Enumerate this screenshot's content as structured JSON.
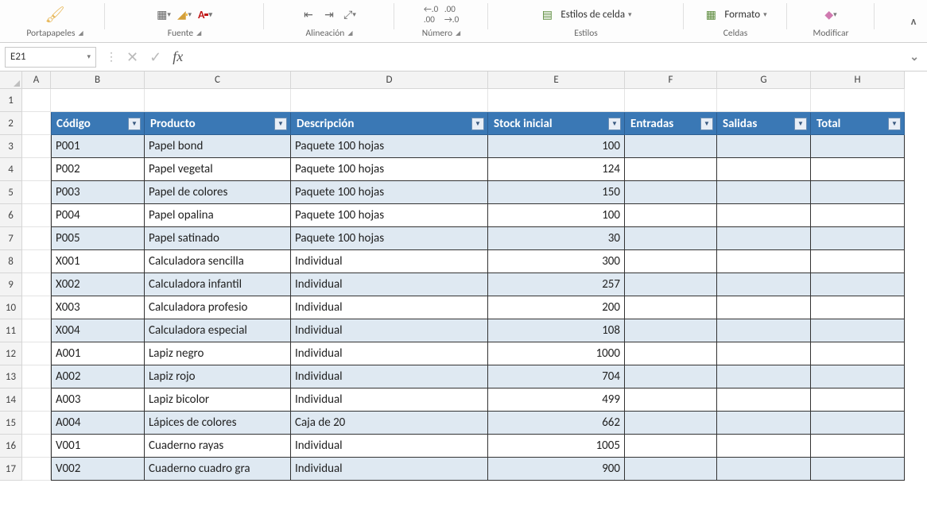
{
  "ribbon": {
    "groups": {
      "portapapeles": "Portapapeles",
      "fuente": "Fuente",
      "alineacion": "Alineación",
      "numero": "Número",
      "estilos": "Estilos",
      "celdas": "Celdas",
      "modificar": "Modificar"
    },
    "buttons": {
      "estilos_celda": "Estilos de celda",
      "formato": "Formato"
    }
  },
  "nameBox": "E21",
  "formulaBar": "",
  "columns": [
    "A",
    "B",
    "C",
    "D",
    "E",
    "F",
    "G",
    "H"
  ],
  "rowNumbers": [
    "1",
    "2",
    "3",
    "4",
    "5",
    "6",
    "7",
    "8",
    "9",
    "10",
    "11",
    "12",
    "13",
    "14",
    "15",
    "16",
    "17"
  ],
  "table": {
    "headers": [
      "Código",
      "Producto",
      "Descripción",
      "Stock inicial",
      "Entradas",
      "Salidas",
      "Total"
    ],
    "rows": [
      {
        "codigo": "P001",
        "producto": "Papel bond",
        "descripcion": "Paquete 100 hojas",
        "stock": "100",
        "entradas": "",
        "salidas": "",
        "total": ""
      },
      {
        "codigo": "P002",
        "producto": "Papel vegetal",
        "descripcion": "Paquete 100 hojas",
        "stock": "124",
        "entradas": "",
        "salidas": "",
        "total": ""
      },
      {
        "codigo": "P003",
        "producto": "Papel de colores",
        "descripcion": "Paquete 100 hojas",
        "stock": "150",
        "entradas": "",
        "salidas": "",
        "total": ""
      },
      {
        "codigo": "P004",
        "producto": "Papel opalina",
        "descripcion": "Paquete 100 hojas",
        "stock": "100",
        "entradas": "",
        "salidas": "",
        "total": ""
      },
      {
        "codigo": "P005",
        "producto": "Papel satinado",
        "descripcion": "Paquete 100 hojas",
        "stock": "30",
        "entradas": "",
        "salidas": "",
        "total": ""
      },
      {
        "codigo": "X001",
        "producto": "Calculadora sencilla",
        "descripcion": "Individual",
        "stock": "300",
        "entradas": "",
        "salidas": "",
        "total": ""
      },
      {
        "codigo": "X002",
        "producto": "Calculadora infantil",
        "descripcion": "Individual",
        "stock": "257",
        "entradas": "",
        "salidas": "",
        "total": ""
      },
      {
        "codigo": "X003",
        "producto": "Calculadora profesio",
        "descripcion": "Individual",
        "stock": "200",
        "entradas": "",
        "salidas": "",
        "total": ""
      },
      {
        "codigo": "X004",
        "producto": "Calculadora especial",
        "descripcion": "Individual",
        "stock": "108",
        "entradas": "",
        "salidas": "",
        "total": ""
      },
      {
        "codigo": "A001",
        "producto": "Lapiz negro",
        "descripcion": "Individual",
        "stock": "1000",
        "entradas": "",
        "salidas": "",
        "total": ""
      },
      {
        "codigo": "A002",
        "producto": "Lapiz rojo",
        "descripcion": "Individual",
        "stock": "704",
        "entradas": "",
        "salidas": "",
        "total": ""
      },
      {
        "codigo": "A003",
        "producto": "Lapiz bicolor",
        "descripcion": "Individual",
        "stock": "499",
        "entradas": "",
        "salidas": "",
        "total": ""
      },
      {
        "codigo": "A004",
        "producto": "Lápices de colores",
        "descripcion": "Caja de 20",
        "stock": "662",
        "entradas": "",
        "salidas": "",
        "total": ""
      },
      {
        "codigo": "V001",
        "producto": "Cuaderno rayas",
        "descripcion": "Individual",
        "stock": "1005",
        "entradas": "",
        "salidas": "",
        "total": ""
      },
      {
        "codigo": "V002",
        "producto": "Cuaderno cuadro gra",
        "descripcion": "Individual",
        "stock": "900",
        "entradas": "",
        "salidas": "",
        "total": ""
      }
    ]
  }
}
